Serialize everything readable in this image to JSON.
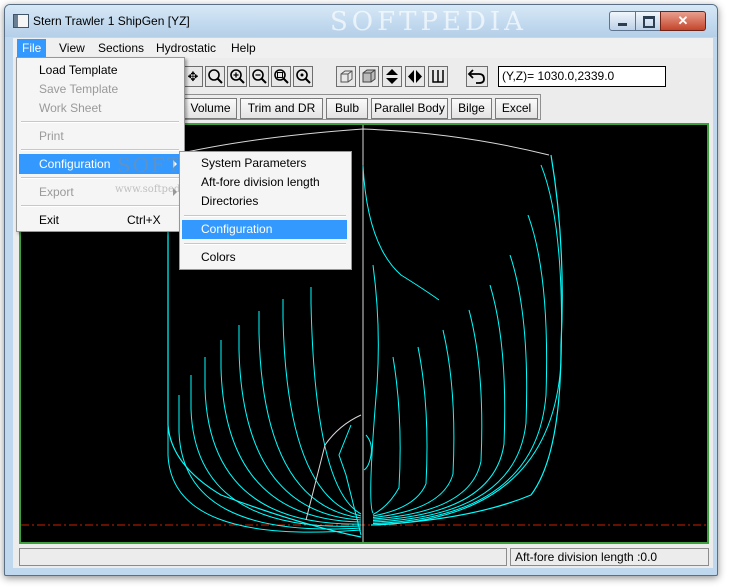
{
  "window": {
    "title": "Stern Trawler  1 ShipGen [YZ]",
    "watermark": "SOFTPEDIA"
  },
  "menubar": {
    "items": [
      "File",
      "View",
      "Sections",
      "Hydrostatic",
      "Help"
    ]
  },
  "toolbar": {
    "icons": [
      "pan-icon",
      "zoom-window-icon",
      "zoom-in-icon",
      "zoom-out-icon",
      "zoom-all-icon",
      "zoom-fit-icon",
      "cube-view-icon",
      "box-view-icon",
      "flip-vertical-icon",
      "flip-horizontal-icon",
      "section-view-icon",
      "undo-icon"
    ],
    "coordinates": "(Y,Z)= 1030.0,2339.0"
  },
  "toolbar2": {
    "buttons": [
      "Volume",
      "Trim and DR",
      "Bulb",
      "Parallel Body",
      "Bilge",
      "Excel"
    ]
  },
  "file_menu": {
    "items": [
      {
        "label": "Load Template",
        "enabled": true
      },
      {
        "label": "Save Template",
        "enabled": false
      },
      {
        "label": "Work Sheet",
        "enabled": false
      },
      {
        "label": "Print",
        "enabled": false
      },
      {
        "label": "Configuration",
        "enabled": true,
        "submenu": true,
        "highlighted": true
      },
      {
        "label": "Export",
        "enabled": false,
        "submenu": true
      },
      {
        "label": "Exit",
        "enabled": true,
        "shortcut": "Ctrl+X"
      }
    ],
    "watermark": "SOFTPEDIA",
    "watermark_url": "www.softpedia.com"
  },
  "config_submenu": {
    "items": [
      "System Parameters",
      "Aft-fore division length",
      "Directories",
      "Configuration",
      "Colors"
    ],
    "highlighted": "Configuration"
  },
  "status": {
    "left": "",
    "right": "Aft-fore division length :0.0"
  },
  "colors": {
    "canvas_bg": "#000000",
    "hull_lines": "#00ffff",
    "centerline": "#d8d8d8",
    "baseline": "#cc2200",
    "canvas_border": "#3ca03c",
    "highlight": "#3399ff"
  }
}
